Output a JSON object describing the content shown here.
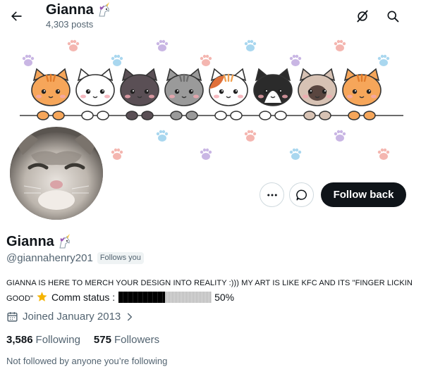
{
  "header": {
    "name": "Gianna",
    "name_emoji": "unicorn-emoji",
    "posts": "4,303 posts"
  },
  "icons": {
    "back": "arrow-left-icon",
    "grok": "grok-icon",
    "search": "search-icon",
    "more": "more-dots-icon",
    "message": "message-icon",
    "calendar": "calendar-icon",
    "chevron": "chevron-right-icon",
    "star": "star-emoji"
  },
  "actions": {
    "follow_back": "Follow back"
  },
  "profile": {
    "name": "Gianna",
    "handle": "@giannahenry201",
    "follows_you": "Follows you",
    "bio_caps": "GIANNA IS HERE TO MERCH YOUR DESIGN INTO REALITY :))) MY ART IS LIKE KFC AND ITS \"FINGER LICKIN GOOD\"",
    "bio_comm": "Comm status :",
    "comm_progress": 0.5,
    "comm_percent": "50%",
    "joined": "Joined January 2013",
    "following_count": "3,586",
    "following_label": "Following",
    "followers_count": "575",
    "followers_label": "Followers",
    "not_followed": "Not followed by anyone you’re following"
  },
  "colors": {
    "text": "#0f1419",
    "secondary": "#536471",
    "button_dark": "#0f1419",
    "border": "#cfd9de"
  }
}
